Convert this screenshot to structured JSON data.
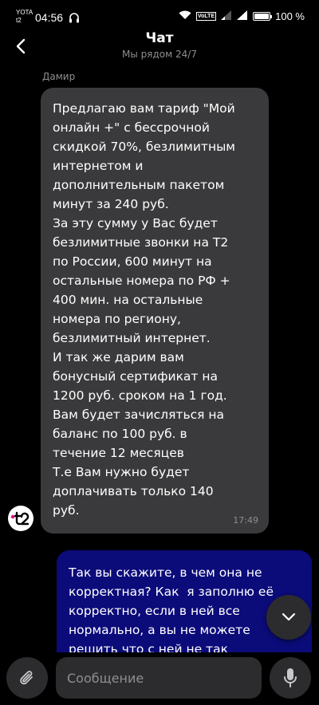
{
  "status_bar": {
    "carrier_line1": "YOTA",
    "carrier_line2": "t2",
    "time": "04:56",
    "volte": "VoLTE",
    "battery_percent": "100 %",
    "battery_level": 1.0
  },
  "header": {
    "title": "Чат",
    "subtitle": "Мы рядом 24/7"
  },
  "messages": {
    "incoming": {
      "sender": "Дамир",
      "text": "Предлагаю вам тариф \"Мой\nонлайн +\" с бессрочной\nскидкой 70%, безлимитным\nинтернетом и\nдополнительным пакетом\nминут за 240 руб.\nЗа эту сумму у Вас будет\nбезлимитные звонки на Т2\nпо России, 600 минут на\nостальные номера по РФ +\n400 мин. на остальные\nномера по региону,\nбезлимитный интернет.\nИ так же дарим вам\nбонусный сертификат на\n1200 руб. сроком на 1 год.\nВам будет зачисляться на\nбаланс по 100 руб. в\nтечение 12 месяцев\nТ.е Вам нужно будет\nдоплачивать только 140\nруб.",
      "time": "17:49",
      "avatar_label": "t2"
    },
    "outgoing": {
      "text": "Так вы скажите, в чем она не\nкорректная? Как  я заполню её\nкорректно, если в ней все\nнормально, а вы не можете\nрешить что с ней не так"
    }
  },
  "input_bar": {
    "placeholder": "Сообщение"
  },
  "colors": {
    "background": "#000000",
    "incoming_bubble": "#3a3a3c",
    "outgoing_bubble": "#0b0b7a",
    "muted_text": "#8e8e93",
    "brand_accent": "#e5007e"
  }
}
